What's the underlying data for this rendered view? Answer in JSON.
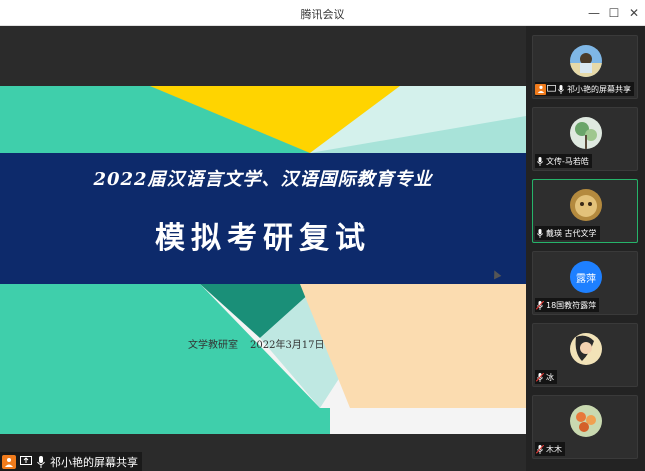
{
  "window": {
    "title": "腾讯会议",
    "minimize": "—",
    "maximize": "☐",
    "close": "✕"
  },
  "slide": {
    "line1": "2022届汉语言文学、汉语国际教育专业",
    "line2": "模拟考研复试",
    "department": "文学教研室",
    "date": "2022年3月17日"
  },
  "share_bar": {
    "label": "祁小艳的屏幕共享"
  },
  "participants": [
    {
      "name": "祁小艳的屏幕共享",
      "avatar": "photo-icon",
      "sharing": true
    },
    {
      "name": "文传-马若皓",
      "avatar": "photo-icon"
    },
    {
      "name": "戴瑛 古代文学",
      "avatar": "photo-icon",
      "active": true
    },
    {
      "name": "18国教符露萍",
      "avatar": "text-avatar",
      "avatar_text": "露萍",
      "avatar_color": "#1e80ff"
    },
    {
      "name": "冰",
      "avatar": "photo-icon"
    },
    {
      "name": "木木",
      "avatar": "photo-icon"
    }
  ],
  "colors": {
    "accent_orange": "#f07b1c",
    "band_navy": "#0d2a6b",
    "active_border": "#26b36a"
  }
}
